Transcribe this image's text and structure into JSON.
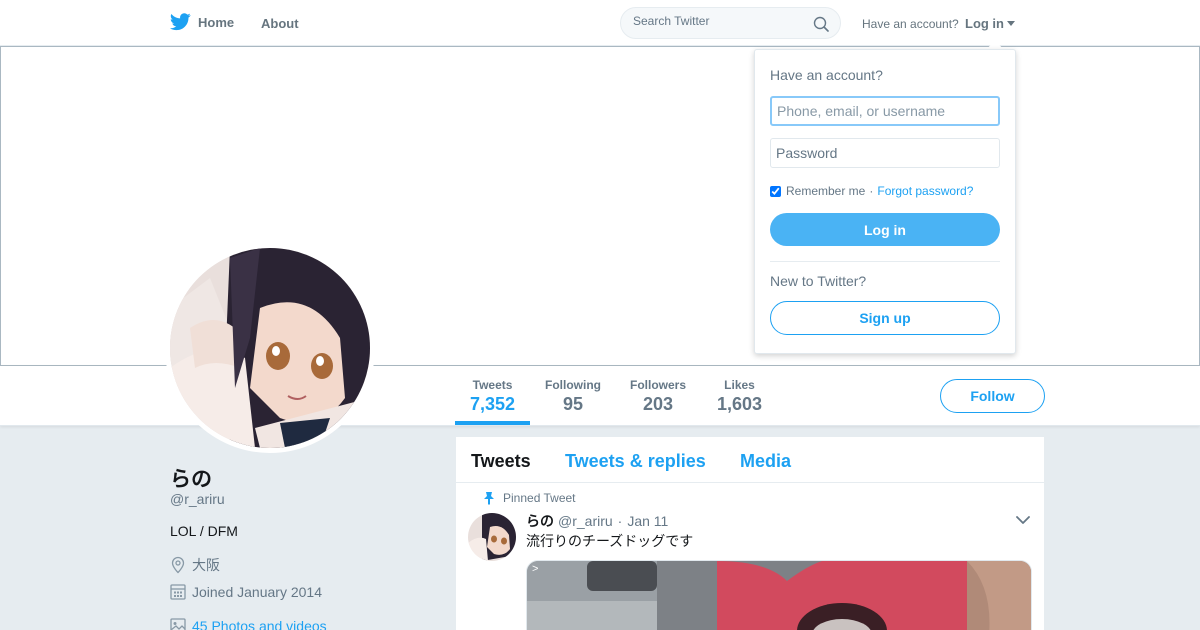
{
  "nav": {
    "home_label": "Home",
    "about_label": "About",
    "search_placeholder": "Search Twitter",
    "have_account": "Have an account?",
    "login_label": "Log in",
    "brand_color": "#1da1f2"
  },
  "profile": {
    "name": "らの",
    "handle": "@r_ariru",
    "bio": "LOL / DFM",
    "location": "大阪",
    "joined": "Joined January 2014",
    "media_link": "45 Photos and videos"
  },
  "stats": [
    {
      "label": "Tweets",
      "value": "7,352",
      "active": true
    },
    {
      "label": "Following",
      "value": "95",
      "active": false
    },
    {
      "label": "Followers",
      "value": "203",
      "active": false
    },
    {
      "label": "Likes",
      "value": "1,603",
      "active": false
    }
  ],
  "follow_label": "Follow",
  "timeline": {
    "tabs": [
      "Tweets",
      "Tweets & replies",
      "Media"
    ],
    "pinned_label": "Pinned Tweet",
    "tweet": {
      "name": "らの",
      "handle": "@r_ariru",
      "dot": "·",
      "date": "Jan 11",
      "text": "流行りのチーズドッグです",
      "media_overlay": ">"
    }
  },
  "login_dropdown": {
    "title": "Have an account?",
    "username_placeholder": "Phone, email, or username",
    "password_placeholder": "Password",
    "remember_label": "Remember me",
    "separator": "·",
    "forgot_label": "Forgot password?",
    "login_button": "Log in",
    "new_label": "New to Twitter?",
    "signup_button": "Sign up"
  },
  "icons": {
    "brand": "twitter-bird-icon",
    "search": "search-icon",
    "caret": "caret-down-icon",
    "location": "location-pin-icon",
    "calendar": "calendar-icon",
    "photo": "photo-icon",
    "pin": "pin-icon",
    "chevron": "chevron-down-icon"
  }
}
